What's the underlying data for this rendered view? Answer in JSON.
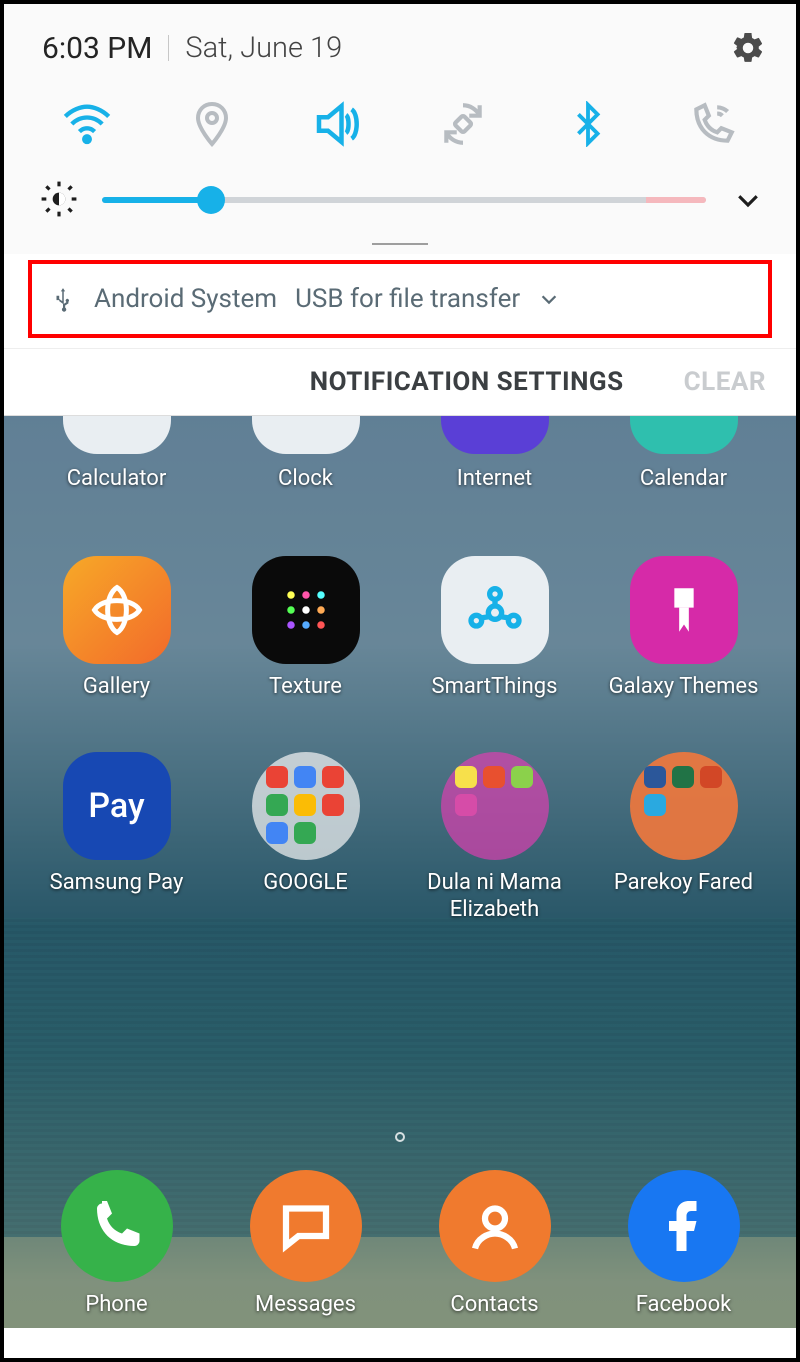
{
  "status": {
    "time": "6:03 PM",
    "date": "Sat, June 19"
  },
  "quick_tiles": [
    {
      "name": "wifi",
      "active": true
    },
    {
      "name": "location",
      "active": false
    },
    {
      "name": "sound",
      "active": true
    },
    {
      "name": "auto-rotate",
      "active": false
    },
    {
      "name": "bluetooth",
      "active": true
    },
    {
      "name": "wifi-calling",
      "active": false
    }
  ],
  "brightness": {
    "percent": 18
  },
  "notification": {
    "source": "Android System",
    "text": "USB for file transfer"
  },
  "actions": {
    "settings": "NOTIFICATION SETTINGS",
    "clear": "CLEAR"
  },
  "peek_apps": [
    {
      "label": "Calculator"
    },
    {
      "label": "Clock"
    },
    {
      "label": "Internet"
    },
    {
      "label": "Calendar"
    }
  ],
  "apps": [
    {
      "label": "Gallery"
    },
    {
      "label": "Texture"
    },
    {
      "label": "SmartThings"
    },
    {
      "label": "Galaxy Themes"
    },
    {
      "label": "Samsung Pay"
    },
    {
      "label": "GOOGLE"
    },
    {
      "label": "Dula ni Mama Elizabeth"
    },
    {
      "label": "Parekoy Fared"
    }
  ],
  "dock": [
    {
      "label": "Phone"
    },
    {
      "label": "Messages"
    },
    {
      "label": "Contacts"
    },
    {
      "label": "Facebook"
    }
  ],
  "colors": {
    "accent": "#17b1e8",
    "highlight_border": "#ff0000",
    "muted_text": "#5a6b75"
  }
}
